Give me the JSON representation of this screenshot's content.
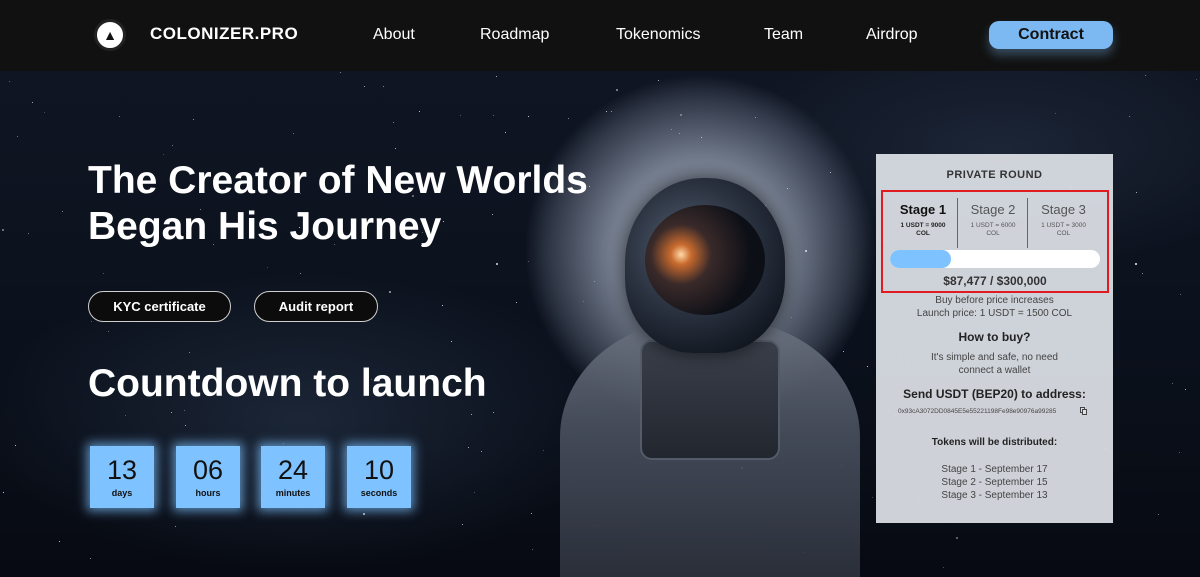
{
  "header": {
    "logo_text": "COLONIZER.PRO",
    "nav": [
      "About",
      "Roadmap",
      "Tokenomics",
      "Team",
      "Airdrop"
    ],
    "contract_label": "Contract"
  },
  "hero": {
    "title_line1": "The Creator of New Worlds",
    "title_line2": "Began His Journey",
    "kyc_label": "KYC certificate",
    "audit_label": "Audit report",
    "countdown_title": "Countdown to launch",
    "countdown": [
      {
        "value": "13",
        "unit": "days"
      },
      {
        "value": "06",
        "unit": "hours"
      },
      {
        "value": "24",
        "unit": "minutes"
      },
      {
        "value": "10",
        "unit": "seconds"
      }
    ]
  },
  "panel": {
    "title": "PRIVATE ROUND",
    "stages": [
      {
        "name": "Stage 1",
        "price": "1 USDT = 9000 COL",
        "active": true
      },
      {
        "name": "Stage 2",
        "price": "1 USDT = 6000 COL",
        "active": false
      },
      {
        "name": "Stage 3",
        "price": "1 USDT = 3000 COL",
        "active": false
      }
    ],
    "progress_fraction": 0.29,
    "raised": "$87,477 / $300,000",
    "buy_before": "Buy before price increases",
    "launch_price": "Launch price: 1 USDT = 1500 COL",
    "how_to_buy": "How to buy?",
    "simple_line1": "It's simple and safe, no need",
    "simple_line2": "connect a wallet",
    "send_title": "Send USDT (BEP20) to address:",
    "address": "0x93cA3072DD0845E5e55221198Fe98e90976a99285",
    "distributed_title": "Tokens will be distributed:",
    "distribution": [
      "Stage 1 - September 17",
      "Stage 2 - September 15",
      "Stage 3 - September 13"
    ]
  },
  "colors": {
    "accent": "#7cb9f2",
    "highlight_border": "#e11b22",
    "header_bg": "#111111"
  }
}
